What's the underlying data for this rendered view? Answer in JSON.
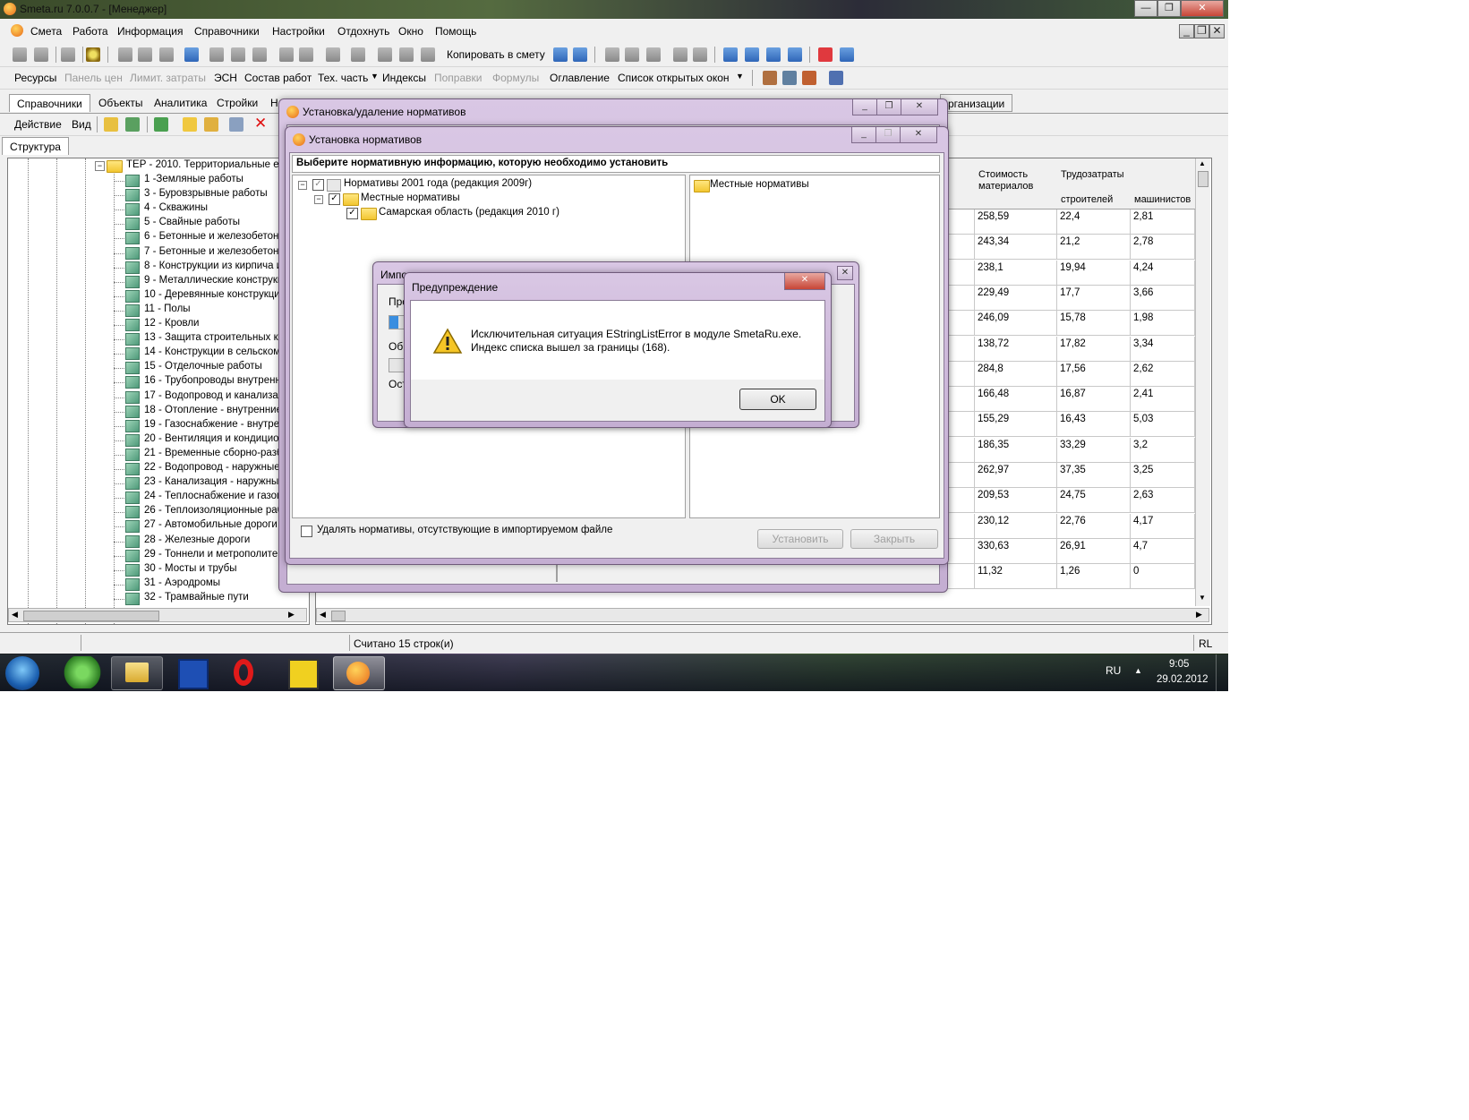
{
  "app": {
    "title": "Smeta.ru  7.0.0.7  - [Менеджер]",
    "sys_buttons": [
      "—",
      "❐",
      "✕"
    ],
    "mdi_buttons": [
      "_",
      "❐",
      "✕"
    ]
  },
  "menu": [
    "Смета",
    "Работа",
    "Информация",
    "Справочники",
    "Настройки",
    "Отдохнуть",
    "Окно",
    "Помощь"
  ],
  "toolbar1": {
    "copy_label": "Копировать в смету"
  },
  "toolbar2": {
    "items": [
      "Ресурсы",
      "Панель цен",
      "Лимит. затраты",
      "ЭСН",
      "Состав работ",
      "Тех. часть",
      "Индексы",
      "Поправки",
      "Формулы",
      "Оглавление",
      "Список открытых окон"
    ],
    "disabled": [
      "Панель цен",
      "Лимит. затраты",
      "Поправки",
      "Формулы"
    ]
  },
  "tabs": [
    "Справочники",
    "Объекты",
    "Аналитика",
    "Стройки",
    "Н"
  ],
  "tab_right": "рганизации",
  "action_bar": {
    "action": "Действие",
    "view": "Вид"
  },
  "left_tab": "Структура",
  "tree": {
    "root": "ТЕР - 2010. Территориальные еди",
    "items": [
      "1 -Земляные работы",
      "3 - Буровзрывные работы",
      "4 - Скважины",
      "5 - Свайные работы",
      "6 - Бетонные и железобетонн",
      "7 - Бетонные и железобетонн",
      "8 - Конструкции из кирпича и",
      "9 - Металлические конструкц",
      "10 - Деревянные конструкци",
      "11 - Полы",
      "12 - Кровли",
      "13 - Защита строительных ко",
      "14 - Конструкции в сельском",
      "15 - Отделочные работы",
      "16 - Трубопроводы внутренни",
      "17 - Водопровод и канализац",
      "18 - Отопление - внутренние у",
      "19 - Газоснабжение - внутрен",
      "20 - Вентиляция и кондицион",
      "21 - Временные сборно-разбо",
      "22 - Водопровод - наружные с",
      "23 - Канализация - наружные",
      "24 - Теплоснабжение и газоп",
      "26 - Теплоизоляционные раб",
      "27 - Автомобильные дороги",
      "28 - Железные дороги",
      "29 - Тоннели и метрополитен",
      "30 - Мосты и трубы",
      "31 - Аэродромы",
      "32 - Трамвайные пути"
    ]
  },
  "grid": {
    "headers": {
      "materials": "Стоимость материалов",
      "labor": "Трудозатраты",
      "builders": "строителей",
      "machinists": "машинистов"
    },
    "rows": [
      [
        "258,59",
        "22,4",
        "2,81"
      ],
      [
        "243,34",
        "21,2",
        "2,78"
      ],
      [
        "238,1",
        "19,94",
        "4,24"
      ],
      [
        "229,49",
        "17,7",
        "3,66"
      ],
      [
        "246,09",
        "15,78",
        "1,98"
      ],
      [
        "138,72",
        "17,82",
        "3,34"
      ],
      [
        "284,8",
        "17,56",
        "2,62"
      ],
      [
        "166,48",
        "16,87",
        "2,41"
      ],
      [
        "155,29",
        "16,43",
        "5,03"
      ],
      [
        "186,35",
        "33,29",
        "3,2"
      ],
      [
        "262,97",
        "37,35",
        "3,25"
      ],
      [
        "209,53",
        "24,75",
        "2,63"
      ],
      [
        "230,12",
        "22,76",
        "4,17"
      ],
      [
        "330,63",
        "26,91",
        "4,7"
      ],
      [
        "11,32",
        "1,26",
        "0"
      ]
    ]
  },
  "dlg_setup_remove": {
    "title": "Установка/удаление нормативов"
  },
  "dlg_setup": {
    "title": "Установка нормативов",
    "header": "Выберите нормативную информацию, которую необходимо установить",
    "tree": [
      "Нормативы 2001 года (редакция 2009г)",
      "Местные нормативы",
      "Самарская область (редакция 2010 г)"
    ],
    "right_item": "Местные нормативы",
    "delete_checkbox": "Удалять нормативы, отсутствующие в импортируемом файле",
    "install_btn": "Установить",
    "close_btn": "Закрыть"
  },
  "dlg_import": {
    "title": "Импорт данных",
    "labels": [
      "Про",
      "Обр",
      "Ост"
    ]
  },
  "dlg_warning": {
    "title": "Предупреждение",
    "line1": "Исключительная ситуация EStringListError в модуле SmetaRu.exe.",
    "line2": "Индекс списка вышел за границы (168).",
    "ok": "OK"
  },
  "status": {
    "text": "Считано 15 строк(и)",
    "lang_right": "RL"
  },
  "taskbar": {
    "lang": "RU",
    "time": "9:05",
    "date": "29.02.2012"
  }
}
